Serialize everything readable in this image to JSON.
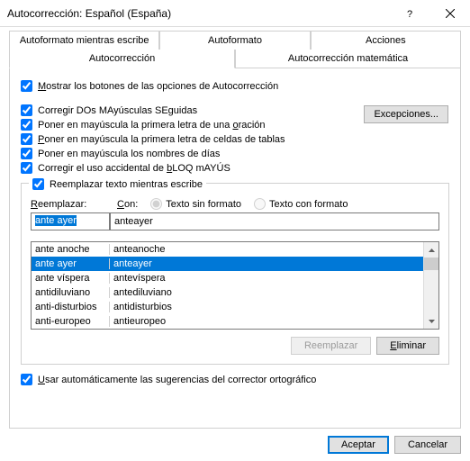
{
  "title": "Autocorrección: Español (España)",
  "tabs": {
    "r1": [
      "Autoformato mientras escribe",
      "Autoformato",
      "Acciones"
    ],
    "r2": [
      "Autocorrección",
      "Autocorrección matemática"
    ]
  },
  "checks": {
    "show_buttons": "ostrar los botones de las opciones de Autocorrección",
    "two_caps": "Corregir DOs MAyúsculas SEguidas",
    "first_sentence": "Poner en mayúscula la primera letra de una ",
    "first_sentence2": "ración",
    "first_cell": "oner en mayúscula la primera letra de celdas de tablas",
    "day_names": "Poner en mayúscula los nombres de días",
    "caps_lock": "Corregir el uso accidental de ",
    "caps_lock2": "LOQ mAYÚS"
  },
  "exceptions": "Excepciones...",
  "replace_legend": "Reemplazar texto mientras escribe",
  "replace_lbl": "eemplazar:",
  "with_lbl": "on:",
  "radio_plain": "Texto sin formato",
  "radio_fmt": "Texto con formato",
  "input_replace": "ante ayer",
  "input_with": "anteayer",
  "rows": [
    {
      "a": "ante anoche",
      "b": "anteanoche"
    },
    {
      "a": "ante ayer",
      "b": "anteayer"
    },
    {
      "a": "ante víspera",
      "b": "antevíspera"
    },
    {
      "a": "antidiluviano",
      "b": "antediluviano"
    },
    {
      "a": "anti-disturbios",
      "b": "antidisturbios"
    },
    {
      "a": "anti-europeo",
      "b": "antieuropeo"
    }
  ],
  "btn_replace": "Reemplazar",
  "btn_delete": "liminar",
  "auto_suggest": "sar automáticamente las sugerencias del corrector ortográfico",
  "ok": "Aceptar",
  "cancel": "Cancelar"
}
